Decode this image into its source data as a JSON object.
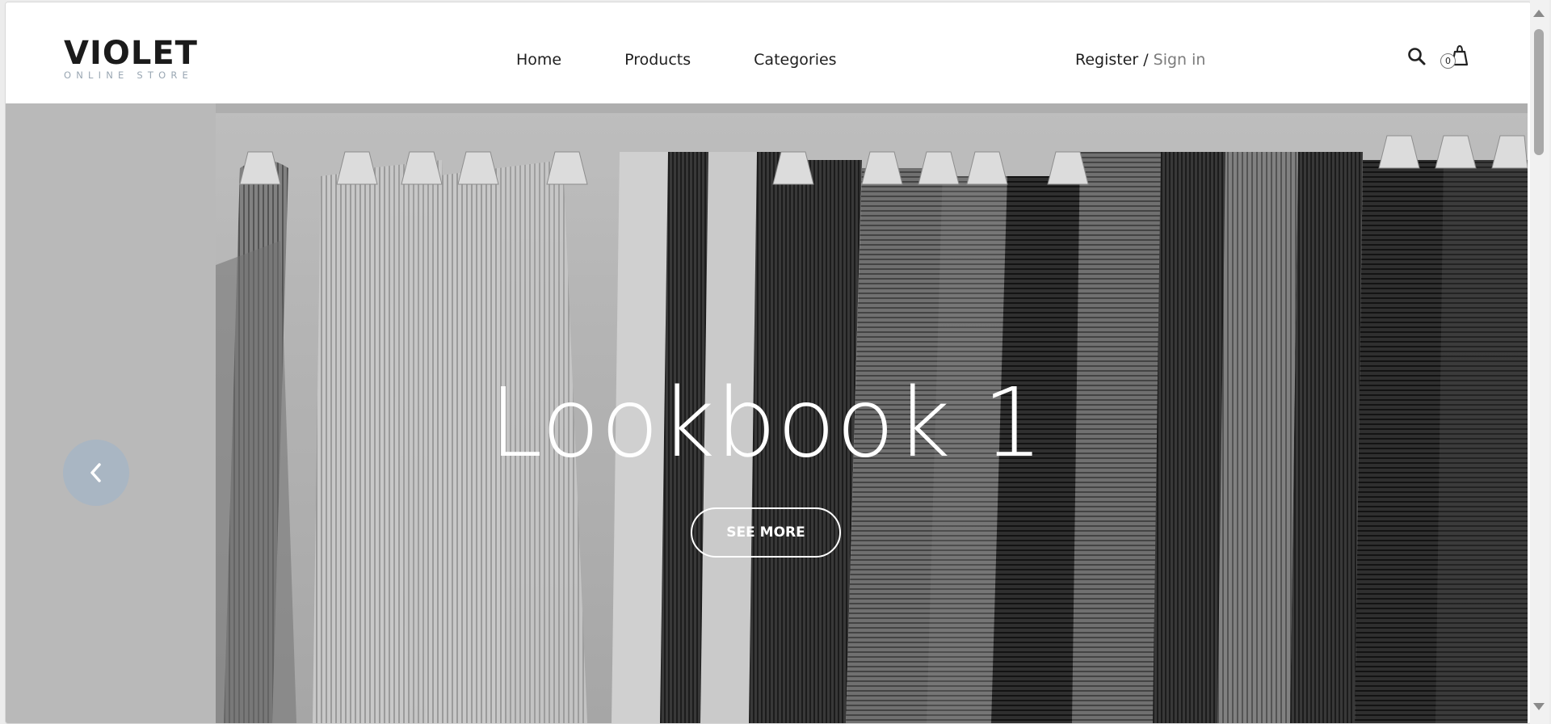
{
  "brand": {
    "name": "VIOLET",
    "tagline": "ONLINE STORE"
  },
  "nav": {
    "items": [
      "Home",
      "Products",
      "Categories"
    ]
  },
  "account": {
    "register": "Register",
    "separator": "/",
    "signin": "Sign in"
  },
  "cart": {
    "count": "0"
  },
  "hero": {
    "title": "Lookbook 1",
    "button": "SEE MORE",
    "prev_icon": "chevron-left-icon"
  },
  "icons": {
    "search": "search-icon",
    "cart": "shopping-bag-icon"
  },
  "colors": {
    "nav_text": "#1f1f1f",
    "signin_text": "#7c7c7c",
    "prev_button_bg": "#a9b6c3",
    "logo_sub": "#9aa7b3"
  }
}
